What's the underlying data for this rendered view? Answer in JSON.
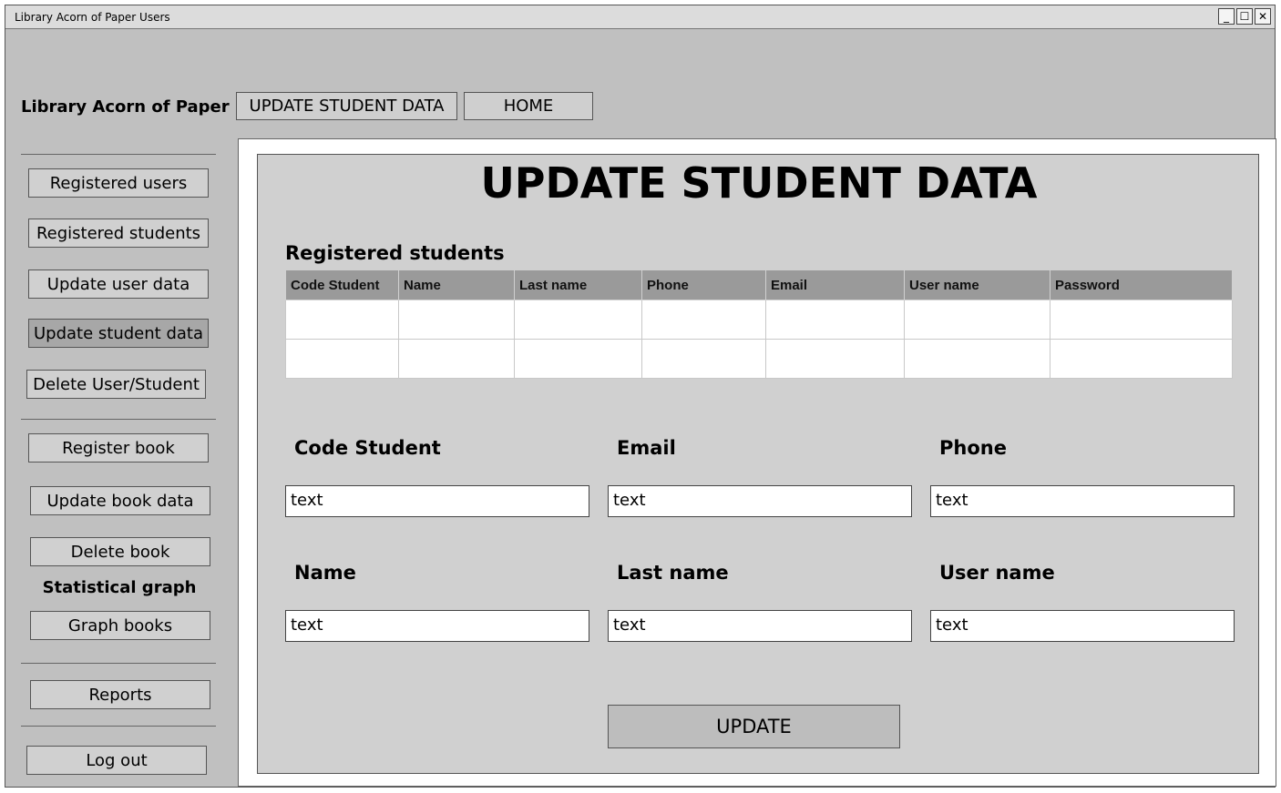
{
  "window": {
    "title": "Library Acorn of Paper Users",
    "controls": {
      "minimize": "_",
      "maximize": "☐",
      "close": "✕"
    }
  },
  "header": {
    "brand": "Library Acorn of Paper",
    "tabs": [
      {
        "label": "UPDATE STUDENT DATA"
      },
      {
        "label": "HOME"
      }
    ]
  },
  "sidebar": {
    "items": [
      {
        "label": "Registered users"
      },
      {
        "label": "Registered students"
      },
      {
        "label": "Update user data"
      },
      {
        "label": "Update student data",
        "active": true
      },
      {
        "label": "Delete User/Student"
      },
      {
        "label": "Register book"
      },
      {
        "label": "Update book data"
      },
      {
        "label": "Delete book"
      },
      {
        "label": "Graph books"
      },
      {
        "label": "Reports"
      },
      {
        "label": "Log out"
      }
    ],
    "section_heading": "Statistical graph"
  },
  "main": {
    "title": "UPDATE STUDENT DATA",
    "table_label": "Registered students",
    "table": {
      "columns": [
        "Code Student",
        "Name",
        "Last name",
        "Phone",
        "Email",
        "User name",
        "Password"
      ],
      "rows": [
        [
          "",
          "",
          "",
          "",
          "",
          "",
          ""
        ],
        [
          "",
          "",
          "",
          "",
          "",
          "",
          ""
        ]
      ]
    },
    "fields": {
      "code_student": {
        "label": "Code Student",
        "value": "text"
      },
      "email": {
        "label": "Email",
        "value": "text"
      },
      "phone": {
        "label": "Phone",
        "value": "text"
      },
      "name": {
        "label": "Name",
        "value": "text"
      },
      "last_name": {
        "label": "Last name",
        "value": "text"
      },
      "user_name": {
        "label": "User name",
        "value": "text"
      }
    },
    "update_label": "UPDATE"
  },
  "colors": {
    "chrome": "#c0c0c0",
    "panel": "#d0d0d0",
    "table_header": "#9a9a9a",
    "active_nav": "#a7a7a7"
  }
}
